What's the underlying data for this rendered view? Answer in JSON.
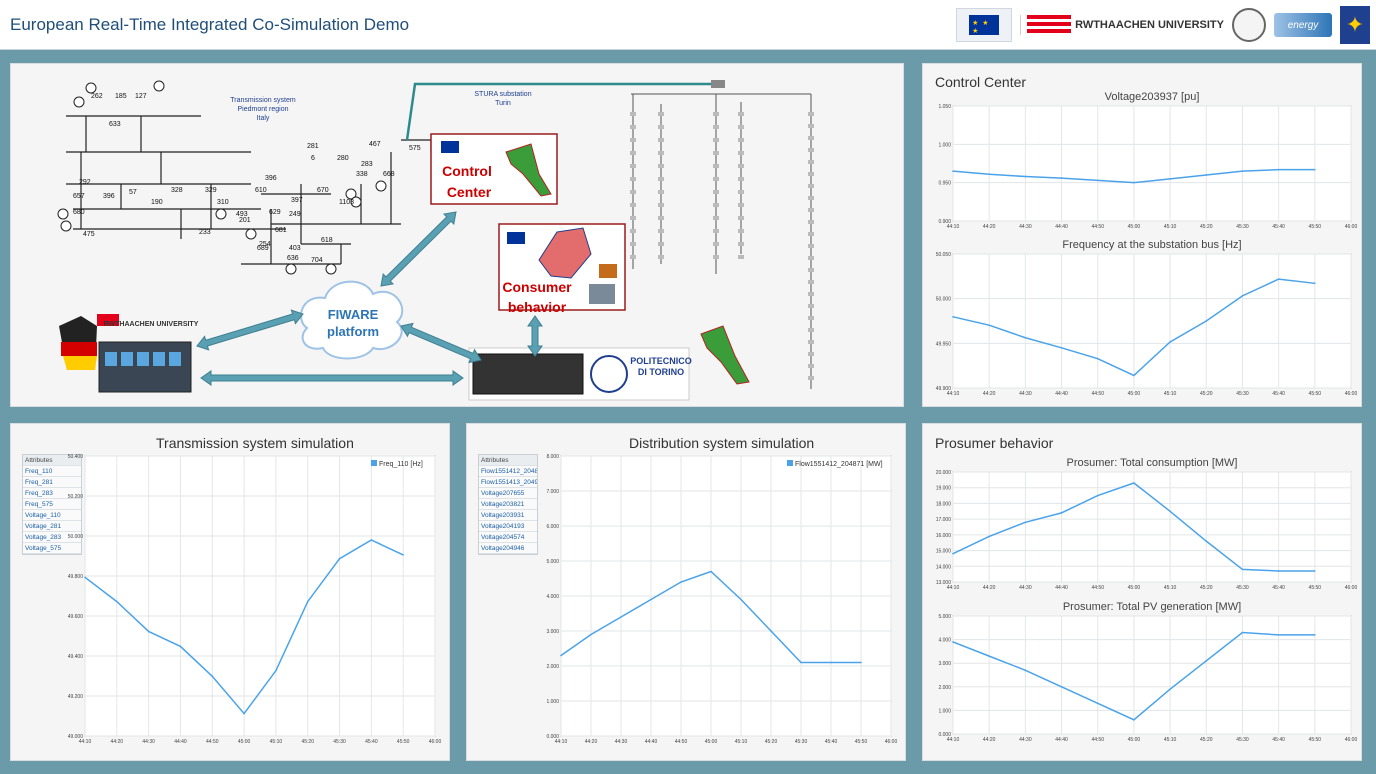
{
  "app_title": "European Real-Time Integrated Co-Simulation Demo",
  "logos": {
    "rwth": "RWTHAACHEN UNIVERSITY",
    "energy": "energy"
  },
  "diagram": {
    "transmission_label": [
      "Transmission system",
      "Piedmont region",
      "Italy"
    ],
    "stura_label": [
      "STURA substation",
      "Turin"
    ],
    "control_center": [
      "Control",
      "Center"
    ],
    "fiware": [
      "FIWARE",
      "platform"
    ],
    "consumer": [
      "Consumer",
      "behavior"
    ],
    "polito": [
      "POLITECNICO",
      "DI TORINO"
    ],
    "rwth_small": "RWTHAACHEN UNIVERSITY",
    "bus_numbers": [
      "262",
      "185",
      "127",
      "633",
      "281",
      "6",
      "280",
      "467",
      "575",
      "283",
      "338",
      "668",
      "292",
      "657",
      "396",
      "57",
      "190",
      "328",
      "329",
      "310",
      "610",
      "396",
      "397",
      "670",
      "1103",
      "680",
      "493",
      "201",
      "629",
      "249",
      "475",
      "233",
      "681",
      "254",
      "403",
      "618",
      "689",
      "636",
      "704"
    ]
  },
  "control_center": {
    "title": "Control Center",
    "voltage_chart": {
      "title": "Voltage203937 [pu]",
      "y_ticks": [
        "1.050",
        "1.000",
        "0.950",
        "0.900"
      ],
      "x_ticks": [
        "44:10",
        "44:20",
        "44:30",
        "44:40",
        "44:50",
        "45:00",
        "45:10",
        "45:20",
        "45:30",
        "45:40",
        "45:50",
        "46:00"
      ]
    },
    "freq_chart": {
      "title": "Frequency at the substation bus [Hz]",
      "y_ticks": [
        "50.050",
        "50.000",
        "49.950",
        "49.900"
      ],
      "x_ticks": [
        "44:10",
        "44:20",
        "44:30",
        "44:40",
        "44:50",
        "45:00",
        "45:10",
        "45:20",
        "45:30",
        "45:40",
        "45:50",
        "46:00"
      ]
    }
  },
  "transmission": {
    "title": "Transmission system simulation",
    "attributes_header": "Attributes",
    "attributes": [
      "Freq_110",
      "Freq_281",
      "Freq_283",
      "Freq_575",
      "Voltage_110",
      "Voltage_281",
      "Voltage_283",
      "Voltage_575"
    ],
    "legend": "Freq_110 [Hz]",
    "y_ticks": [
      "50.400",
      "50.200",
      "50.000",
      "49.800",
      "49.600",
      "49.400",
      "49.200",
      "49.000"
    ],
    "x_ticks": [
      "44:10",
      "44:20",
      "44:30",
      "44:40",
      "44:50",
      "45:00",
      "45:10",
      "45:20",
      "45:30",
      "45:40",
      "45:50",
      "46:00"
    ]
  },
  "distribution": {
    "title": "Distribution system simulation",
    "attributes_header": "Attributes",
    "attributes": [
      "Flow1551412_204871",
      "Flow1551413_204946",
      "Voltage207655",
      "Voltage203821",
      "Voltage203931",
      "Voltage204193",
      "Voltage204574",
      "Voltage204946"
    ],
    "legend": "Flow1551412_204871 [MW]",
    "y_ticks": [
      "8.000",
      "7.000",
      "6.000",
      "5.000",
      "4.000",
      "3.000",
      "2.000",
      "1.000",
      "0.000"
    ],
    "x_ticks": [
      "44:10",
      "44:20",
      "44:30",
      "44:40",
      "44:50",
      "45:00",
      "45:10",
      "45:20",
      "45:30",
      "45:40",
      "45:50",
      "46:00"
    ]
  },
  "prosumer": {
    "title": "Prosumer behavior",
    "consumption_chart": {
      "title": "Prosumer: Total consumption [MW]",
      "y_ticks": [
        "20.000",
        "19.000",
        "18.000",
        "17.000",
        "16.000",
        "15.000",
        "14.000",
        "13.000"
      ],
      "x_ticks": [
        "44:10",
        "44:20",
        "44:30",
        "44:40",
        "44:50",
        "45:00",
        "45:10",
        "45:20",
        "45:30",
        "45:40",
        "45:50",
        "46:00"
      ]
    },
    "pv_chart": {
      "title": "Prosumer: Total PV generation [MW]",
      "y_ticks": [
        "5.000",
        "4.000",
        "3.000",
        "2.000",
        "1.000",
        "0.000"
      ],
      "x_ticks": [
        "44:10",
        "44:20",
        "44:30",
        "44:40",
        "44:50",
        "45:00",
        "45:10",
        "45:20",
        "45:30",
        "45:40",
        "45:50",
        "46:00"
      ]
    }
  },
  "chart_data": [
    {
      "type": "line",
      "title": "Voltage203937 [pu]",
      "x": [
        "44:10",
        "44:20",
        "44:30",
        "44:40",
        "44:50",
        "45:00",
        "45:10",
        "45:20",
        "45:30",
        "45:40",
        "45:50"
      ],
      "series": [
        {
          "values": [
            0.965,
            0.961,
            0.958,
            0.956,
            0.953,
            0.95,
            0.955,
            0.96,
            0.965,
            0.967,
            0.967
          ]
        }
      ],
      "ylim": [
        0.9,
        1.05
      ],
      "color": "#4aa3ea"
    },
    {
      "type": "line",
      "title": "Frequency at the substation bus [Hz]",
      "x": [
        "44:10",
        "44:20",
        "44:30",
        "44:40",
        "44:50",
        "45:00",
        "45:10",
        "45:20",
        "45:30",
        "45:40",
        "45:50"
      ],
      "series": [
        {
          "values": [
            49.985,
            49.975,
            49.96,
            49.948,
            49.935,
            49.915,
            49.955,
            49.98,
            50.01,
            50.03,
            50.025
          ]
        }
      ],
      "ylim": [
        49.9,
        50.06
      ],
      "color": "#4aa3ea"
    },
    {
      "type": "line",
      "title": "Transmission system simulation",
      "x": [
        "44:10",
        "44:20",
        "44:30",
        "44:40",
        "44:50",
        "45:00",
        "45:10",
        "45:20",
        "45:30",
        "45:40",
        "45:50"
      ],
      "series": [
        {
          "name": "Freq_110 [Hz]",
          "values": [
            49.85,
            49.72,
            49.56,
            49.48,
            49.32,
            49.12,
            49.35,
            49.72,
            49.95,
            50.05,
            49.97
          ]
        }
      ],
      "ylim": [
        49.0,
        50.5
      ],
      "color": "#4aa3ea"
    },
    {
      "type": "line",
      "title": "Distribution system simulation",
      "x": [
        "44:10",
        "44:20",
        "44:30",
        "44:40",
        "44:50",
        "45:00",
        "45:10",
        "45:20",
        "45:30",
        "45:40",
        "45:50"
      ],
      "series": [
        {
          "name": "Flow1551412_204871 [MW]",
          "values": [
            2.3,
            2.9,
            3.4,
            3.9,
            4.4,
            4.7,
            3.9,
            3.0,
            2.1,
            2.1,
            2.1
          ]
        }
      ],
      "ylim": [
        0,
        8
      ],
      "color": "#4aa3ea"
    },
    {
      "type": "line",
      "title": "Prosumer: Total consumption [MW]",
      "x": [
        "44:10",
        "44:20",
        "44:30",
        "44:40",
        "44:50",
        "45:00",
        "45:10",
        "45:20",
        "45:30",
        "45:40",
        "45:50"
      ],
      "series": [
        {
          "values": [
            14.8,
            15.9,
            16.8,
            17.4,
            18.5,
            19.3,
            17.5,
            15.6,
            13.8,
            13.7,
            13.7
          ]
        }
      ],
      "ylim": [
        13,
        20
      ],
      "color": "#4aa3ea"
    },
    {
      "type": "line",
      "title": "Prosumer: Total PV generation [MW]",
      "x": [
        "44:10",
        "44:20",
        "44:30",
        "44:40",
        "44:50",
        "45:00",
        "45:10",
        "45:20",
        "45:30",
        "45:40",
        "45:50"
      ],
      "series": [
        {
          "values": [
            3.9,
            3.3,
            2.7,
            2.0,
            1.3,
            0.6,
            1.9,
            3.1,
            4.3,
            4.2,
            4.2
          ]
        }
      ],
      "ylim": [
        0,
        5
      ],
      "color": "#4aa3ea"
    }
  ]
}
